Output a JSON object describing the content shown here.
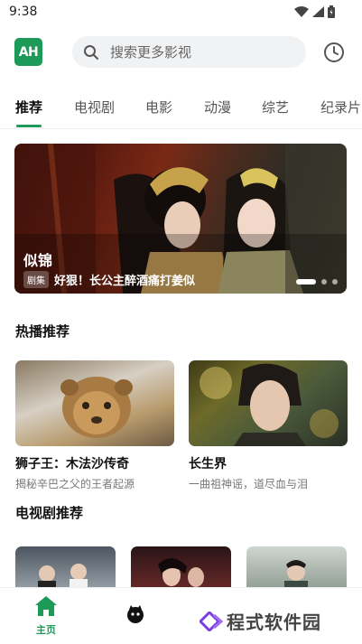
{
  "status_bar": {
    "time": "9:38"
  },
  "header": {
    "logo_text": "AH",
    "search_placeholder": "搜索更多影视"
  },
  "tabs": [
    {
      "label": "推荐",
      "active": true
    },
    {
      "label": "电视剧"
    },
    {
      "label": "电影"
    },
    {
      "label": "动漫"
    },
    {
      "label": "综艺"
    },
    {
      "label": "纪录片"
    }
  ],
  "banner": {
    "title": "似锦",
    "tag": "剧集",
    "subtitle": "好狠！长公主醉酒痛打姜似"
  },
  "hot": {
    "title": "热播推荐",
    "items": [
      {
        "title": "狮子王：木法沙传奇",
        "desc": "揭秘辛巴之父的王者起源"
      },
      {
        "title": "长生界",
        "desc": "一曲祖神谣，道尽血与泪"
      }
    ]
  },
  "tv": {
    "title": "电视剧推荐"
  },
  "bottom_nav": {
    "home_label": "主页"
  },
  "watermark": "程式软件园",
  "colors": {
    "accent": "#1e9a58",
    "watermark": "#7b3fe4"
  }
}
